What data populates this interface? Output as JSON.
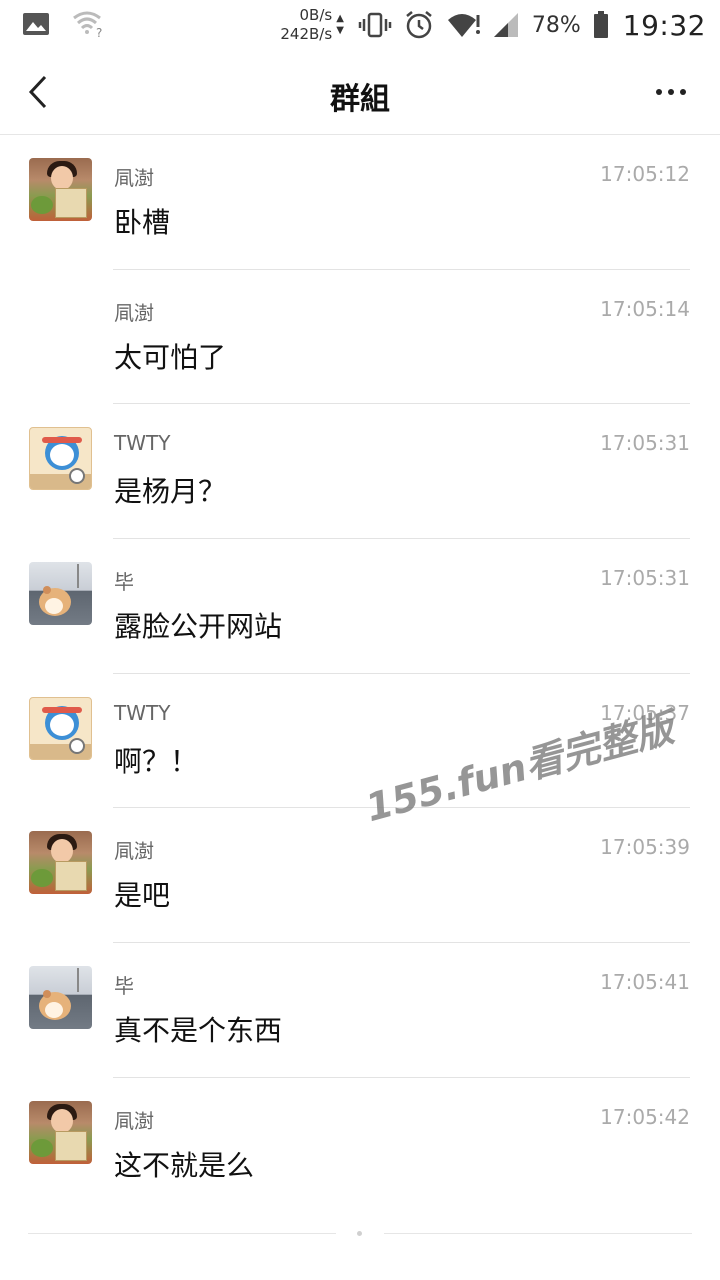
{
  "status_bar": {
    "net_up": "0B/s",
    "net_down": "242B/s",
    "battery": "78%",
    "time": "19:32",
    "icons": [
      "gallery-icon",
      "wifi-unknown-icon",
      "vibrate-icon",
      "alarm-icon",
      "wifi-icon",
      "signal-icon",
      "battery-icon"
    ]
  },
  "header": {
    "title": "群組",
    "back_icon": "chevron-left-icon",
    "more_icon": "more-horizontal-icon"
  },
  "messages": [
    {
      "sender": "凬澍",
      "time": "17:05:12",
      "text": "卧槽",
      "avatar": "girl-reading"
    },
    {
      "sender": "凬澍",
      "time": "17:05:14",
      "text": "太可怕了",
      "avatar": ""
    },
    {
      "sender": "TWTY",
      "time": "17:05:31",
      "text": "是杨月？",
      "avatar": "doraemon"
    },
    {
      "sender": "毕",
      "time": "17:05:31",
      "text": "露脸公开网站",
      "avatar": "hamster"
    },
    {
      "sender": "TWTY",
      "time": "17:05:37",
      "text": "啊？！",
      "avatar": "doraemon"
    },
    {
      "sender": "凬澍",
      "time": "17:05:39",
      "text": "是吧",
      "avatar": "girl-reading"
    },
    {
      "sender": "毕",
      "time": "17:05:41",
      "text": "真不是个东西",
      "avatar": "hamster"
    },
    {
      "sender": "凬澍",
      "time": "17:05:42",
      "text": "这不就是么",
      "avatar": "girl-reading"
    }
  ],
  "watermark": "155.fun看完整版"
}
